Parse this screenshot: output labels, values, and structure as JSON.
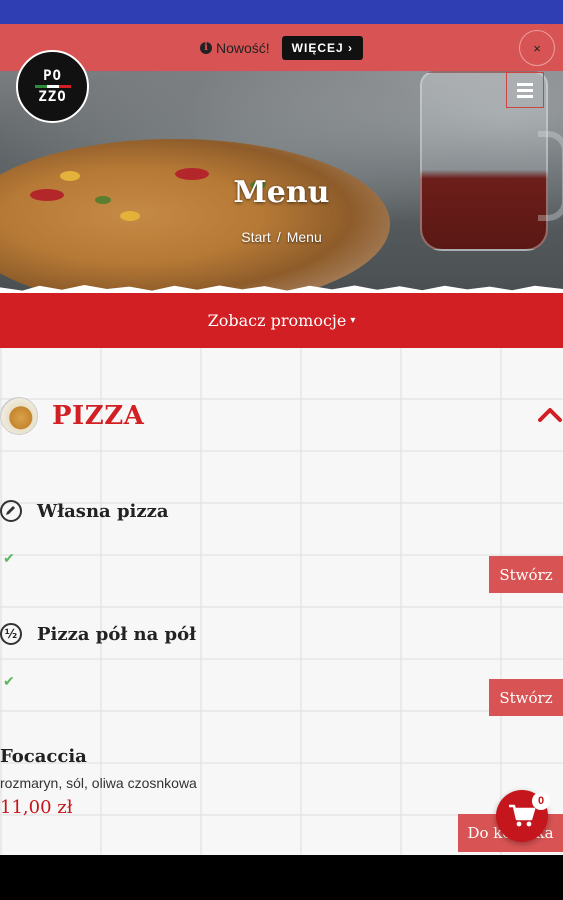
{
  "notice": {
    "text": "Nowość!",
    "button": "WIĘCEJ ›",
    "close": "×"
  },
  "logo": {
    "line1": "PO",
    "line2": "ZZO"
  },
  "hero": {
    "title": "Menu",
    "breadcrumb": [
      "Start",
      "Menu"
    ],
    "separator": "/"
  },
  "promo": {
    "label": "Zobacz promocje",
    "caret": "▾"
  },
  "category": {
    "title": "PIZZA"
  },
  "items": [
    {
      "name": "Własna pizza",
      "check": "✔",
      "button": "Stwórz",
      "icon": "pencil-icon"
    },
    {
      "name": "Pizza pół na pół",
      "check": "✔",
      "button": "Stwórz",
      "icon": "half-half-icon",
      "icon_text": "½"
    },
    {
      "name": "Focaccia",
      "description": "rozmaryn, sól, oliwa czosnkowa",
      "price": "11,00 zł"
    }
  ],
  "cart": {
    "button": "Do koszyka",
    "count": "0"
  },
  "colors": {
    "primary": "#d21f24",
    "notice": "#d85353",
    "topbar": "#2f3eb3",
    "check": "#5cb85c"
  }
}
